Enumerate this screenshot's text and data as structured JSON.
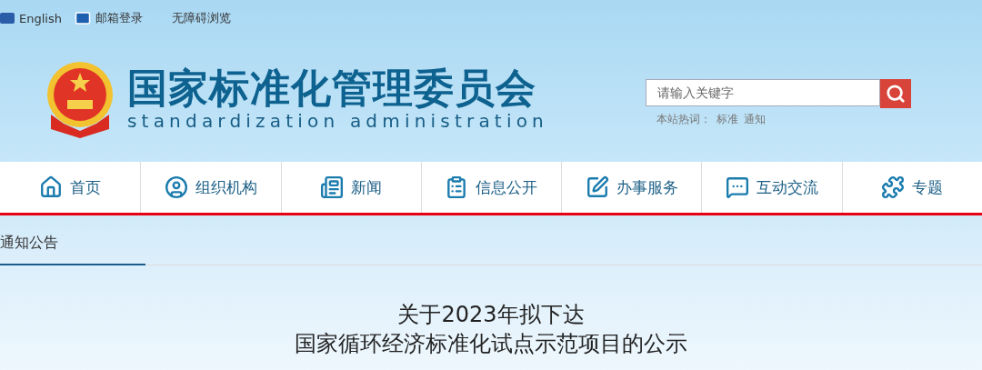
{
  "top_links": [
    "English",
    "邮箱登录",
    "无障碍浏览"
  ],
  "site_title": "国家标准化管理委员会",
  "site_subtitle": "standardization administration",
  "search": {
    "placeholder": "请输入关键字"
  },
  "hot_words": {
    "label": "本站热词：",
    "words": [
      "标准",
      "通知"
    ]
  },
  "nav": [
    {
      "label": "首页"
    },
    {
      "label": "组织机构"
    },
    {
      "label": "新闻"
    },
    {
      "label": "信息公开"
    },
    {
      "label": "办事服务"
    },
    {
      "label": "互动交流"
    },
    {
      "label": "专题"
    }
  ],
  "section_tab": {
    "label": "通知公告",
    "selected": true
  },
  "article_title": [
    "关于2023年拟下达",
    "国家循环经济标准化试点示范项目的公示"
  ]
}
